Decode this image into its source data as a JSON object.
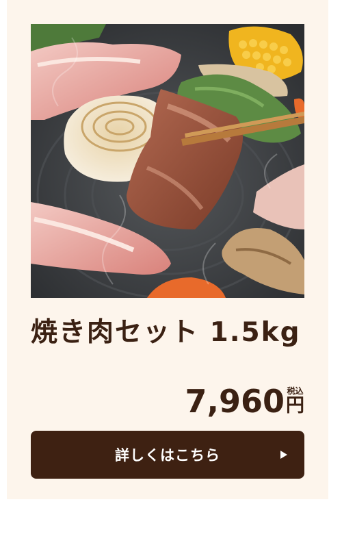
{
  "product": {
    "image_alt": "焼き肉セット",
    "title": "焼き肉セット 1.5kg",
    "price": "7,960",
    "tax_label": "税込",
    "currency": "円"
  },
  "cta": {
    "label": "詳しくはこちら",
    "icon": "triangle-right-icon"
  },
  "colors": {
    "card_bg": "#fdf5ec",
    "text": "#3b2113",
    "button_bg": "#3e2112",
    "button_text": "#ffffff"
  }
}
